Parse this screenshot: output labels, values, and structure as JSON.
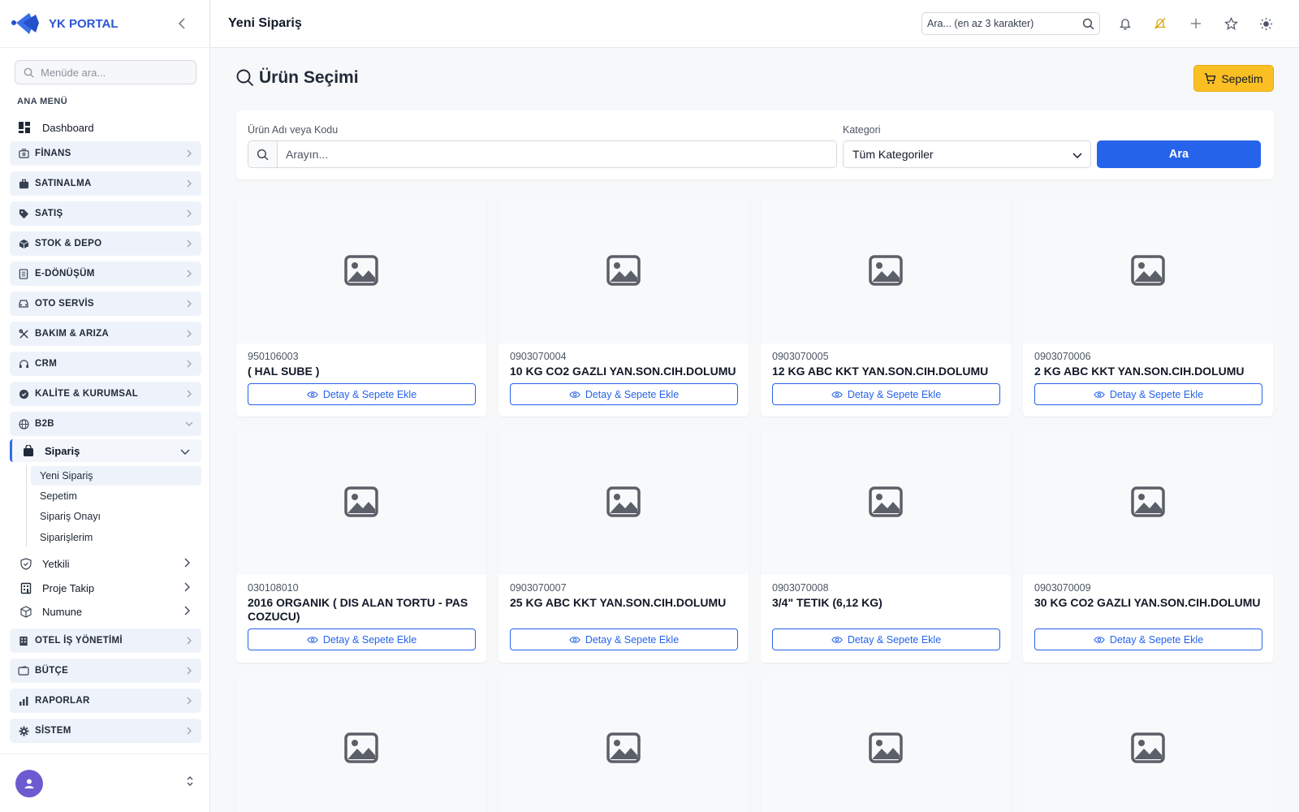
{
  "brand": {
    "name": "YK PORTAL"
  },
  "sidebar": {
    "search_placeholder": "Menüde ara...",
    "section_title": "ANA MENÜ",
    "dashboard_label": "Dashboard",
    "groups_top": [
      {
        "label": "FİNANS",
        "icon": "finance-icon"
      },
      {
        "label": "SATINALMA",
        "icon": "briefcase-icon"
      },
      {
        "label": "SATIŞ",
        "icon": "tag-icon"
      },
      {
        "label": "STOK & DEPO",
        "icon": "box-icon"
      },
      {
        "label": "E-DÖNÜŞÜM",
        "icon": "document-icon"
      },
      {
        "label": "OTO SERVİS",
        "icon": "car-icon"
      },
      {
        "label": "BAKIM & ARIZA",
        "icon": "tools-icon"
      },
      {
        "label": "CRM",
        "icon": "headset-icon"
      },
      {
        "label": "KALİTE & KURUMSAL",
        "icon": "badge-icon"
      },
      {
        "label": "B2B",
        "icon": "globe-icon"
      }
    ],
    "siparis_label": "Sipariş",
    "siparis_children": [
      "Yeni Sipariş",
      "Sepetim",
      "Sipariş Onayı",
      "Siparişlerim"
    ],
    "b2b_children": [
      {
        "label": "Yetkili",
        "icon": "shield-icon"
      },
      {
        "label": "Proje Takip",
        "icon": "building-icon"
      },
      {
        "label": "Numune",
        "icon": "cube-icon"
      }
    ],
    "groups_bottom": [
      {
        "label": "OTEL İŞ YÖNETİMİ",
        "icon": "hotel-icon"
      },
      {
        "label": "BÜTÇE",
        "icon": "wallet-icon"
      },
      {
        "label": "RAPORLAR",
        "icon": "bar-chart-icon"
      },
      {
        "label": "SİSTEM",
        "icon": "gear-icon"
      }
    ]
  },
  "topbar": {
    "page_title": "Yeni Sipariş",
    "search_placeholder": "Ara... (en az 3 karakter)"
  },
  "main": {
    "heading": "Ürün Seçimi",
    "cart_label": "Sepetim",
    "filter": {
      "product_label": "Ürün Adı veya Kodu",
      "product_placeholder": "Arayın...",
      "category_label": "Kategori",
      "category_value": "Tüm Kategoriler",
      "search_button": "Ara"
    },
    "detail_button_label": "Detay & Sepete Ekle",
    "products": [
      {
        "code": "950106003",
        "name": "( HAL SUBE )"
      },
      {
        "code": "0903070004",
        "name": "10 KG CO2 GAZLI YAN.SON.CIH.DOLUMU"
      },
      {
        "code": "0903070005",
        "name": "12 KG ABC KKT YAN.SON.CIH.DOLUMU"
      },
      {
        "code": "0903070006",
        "name": "2 KG ABC KKT YAN.SON.CIH.DOLUMU"
      },
      {
        "code": "030108010",
        "name": "2016 ORGANIK ( DIS ALAN TORTU - PAS COZUCU)"
      },
      {
        "code": "0903070007",
        "name": "25 KG ABC KKT YAN.SON.CIH.DOLUMU"
      },
      {
        "code": "0903070008",
        "name": "3/4\" TETIK (6,12 KG)"
      },
      {
        "code": "0903070009",
        "name": "30 KG CO2 GAZLI YAN.SON.CIH.DOLUMU"
      }
    ]
  },
  "colors": {
    "accent": "#2563eb",
    "cart": "#fbbf24",
    "brand": "#2c56d6"
  }
}
